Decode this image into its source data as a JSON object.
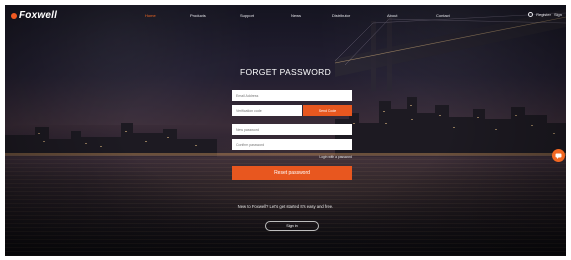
{
  "brand": {
    "name": "Foxwell"
  },
  "nav": {
    "items": [
      {
        "label": "Home",
        "active": true
      },
      {
        "label": "Products",
        "active": false
      },
      {
        "label": "Support",
        "active": false
      },
      {
        "label": "News",
        "active": false
      },
      {
        "label": "Distributor",
        "active": false
      },
      {
        "label": "About",
        "active": false
      },
      {
        "label": "Contact",
        "active": false
      }
    ]
  },
  "header_right": {
    "register": "Register",
    "signin": "Sign"
  },
  "form": {
    "title": "FORGET PASSWORD",
    "email_placeholder": "Email Address",
    "code_placeholder": "Verification code",
    "send_code_label": "Send Code",
    "new_password_placeholder": "New password",
    "confirm_password_placeholder": "Confirm password",
    "login_link": "Login with a password",
    "reset_label": "Reset password",
    "new_to_text": "New to Foxwell? Let's get started It's easy and free.",
    "signin_label": "Sign in"
  },
  "icons": {
    "search": "search-icon",
    "chat": "chat-icon"
  },
  "colors": {
    "accent": "#e8571f",
    "nav_active": "#f26722",
    "text_light": "#ffffff"
  }
}
